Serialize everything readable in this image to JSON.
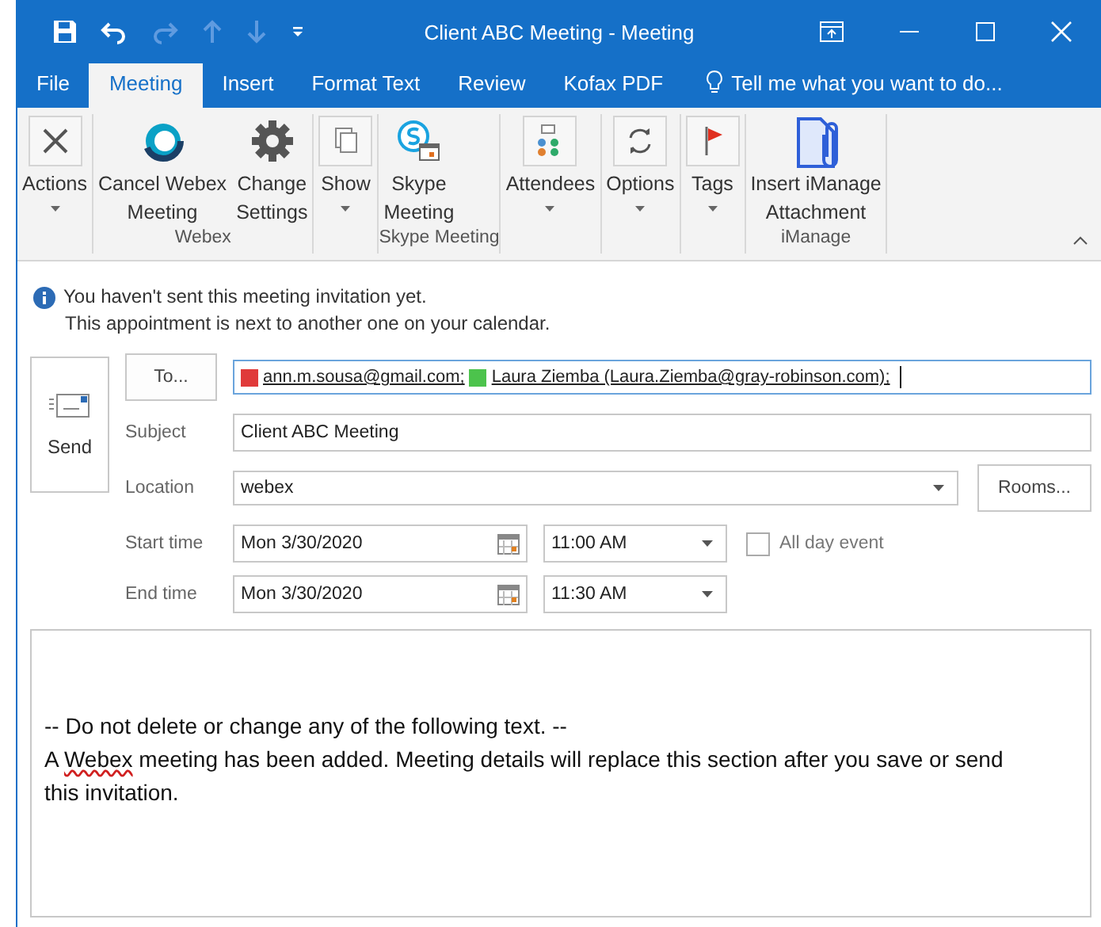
{
  "window": {
    "title": "Client ABC Meeting - Meeting"
  },
  "tabs": [
    {
      "label": "File",
      "selected": false
    },
    {
      "label": "Meeting",
      "selected": true
    },
    {
      "label": "Insert",
      "selected": false
    },
    {
      "label": "Format Text",
      "selected": false
    },
    {
      "label": "Review",
      "selected": false
    },
    {
      "label": "Kofax PDF",
      "selected": false
    }
  ],
  "tell_me": {
    "placeholder": "Tell me what you want to do..."
  },
  "ribbon": {
    "groups": [
      {
        "buttons": [
          {
            "lines": [
              "Actions"
            ],
            "dropdown": true
          }
        ]
      },
      {
        "label": "Webex",
        "buttons": [
          {
            "lines": [
              "Cancel Webex",
              "Meeting"
            ],
            "dropdown": false
          },
          {
            "lines": [
              "Change",
              "Settings"
            ],
            "dropdown": false
          }
        ]
      },
      {
        "buttons": [
          {
            "lines": [
              "Show"
            ],
            "dropdown": true
          }
        ]
      },
      {
        "label": "Skype Meeting",
        "buttons": [
          {
            "lines": [
              "Skype",
              "Meeting"
            ],
            "dropdown": false
          }
        ]
      },
      {
        "buttons": [
          {
            "lines": [
              "Attendees"
            ],
            "dropdown": true
          }
        ]
      },
      {
        "buttons": [
          {
            "lines": [
              "Options"
            ],
            "dropdown": true
          }
        ]
      },
      {
        "buttons": [
          {
            "lines": [
              "Tags"
            ],
            "dropdown": true
          }
        ]
      },
      {
        "label": "iManage",
        "buttons": [
          {
            "lines": [
              "Insert iManage",
              "Attachment"
            ],
            "dropdown": false
          }
        ]
      }
    ]
  },
  "info": [
    "You haven't sent this meeting invitation yet.",
    "This appointment is next to another one on your calendar."
  ],
  "send_button": "Send",
  "to_button": "To...",
  "recipients": [
    {
      "text": "ann.m.sousa@gmail.com;",
      "color": "#e03a3a"
    },
    {
      "text": "Laura Ziemba (Laura.Ziemba@gray-robinson.com);",
      "color": "#4cc34c"
    }
  ],
  "subject": {
    "label": "Subject",
    "value": "Client ABC Meeting"
  },
  "location": {
    "label": "Location",
    "value": "webex"
  },
  "rooms_button": "Rooms...",
  "start": {
    "label": "Start time",
    "date": "Mon 3/30/2020",
    "time": "11:00 AM"
  },
  "end": {
    "label": "End time",
    "date": "Mon 3/30/2020",
    "time": "11:30 AM"
  },
  "all_day": {
    "label": "All day event",
    "checked": false
  },
  "body": [
    "-- Do not delete or change any of the following text. --",
    "A **Webex** meeting has been added. Meeting details will replace this section after you save or send this invitation."
  ]
}
